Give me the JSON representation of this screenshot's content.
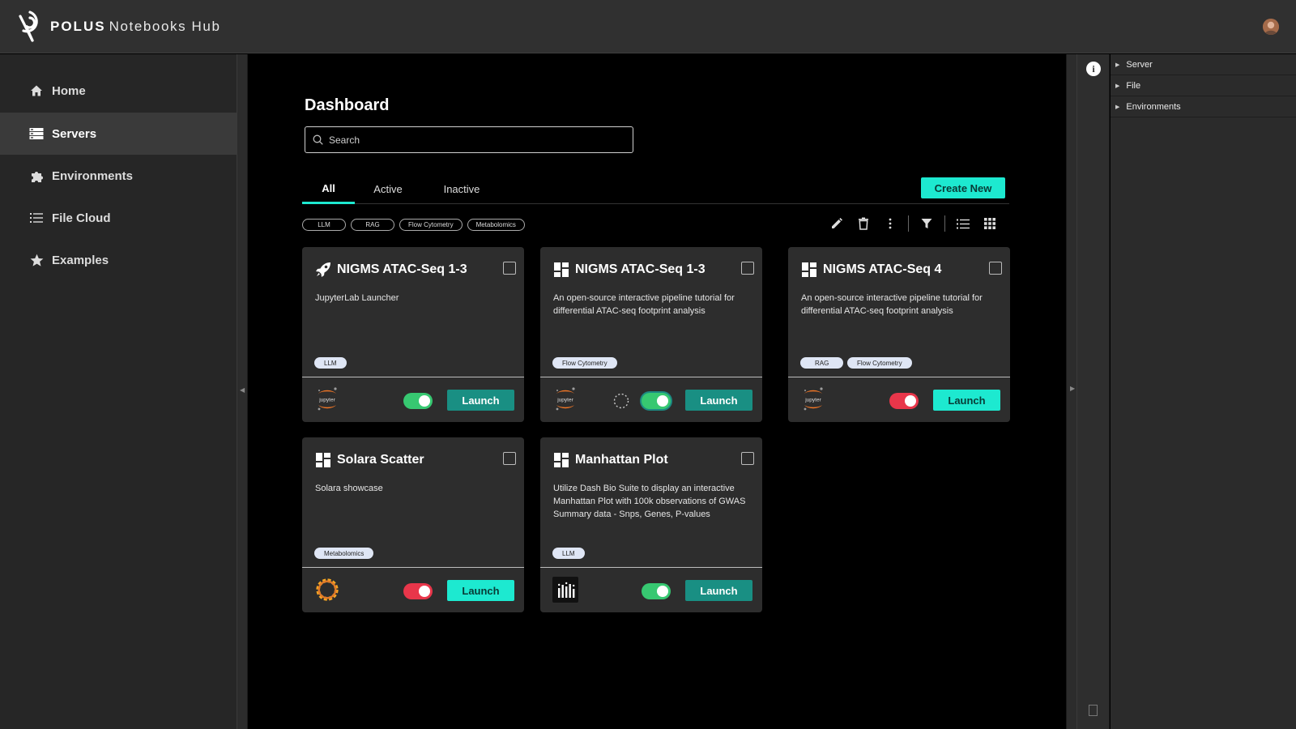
{
  "header": {
    "brand_name": "POLUS",
    "brand_suffix": "Notebooks Hub",
    "avatar_icon": "user-avatar-icon"
  },
  "sidebar": {
    "items": [
      {
        "label": "Home",
        "icon": "home-icon",
        "active": false
      },
      {
        "label": "Servers",
        "icon": "servers-icon",
        "active": true
      },
      {
        "label": "Environments",
        "icon": "puzzle-icon",
        "active": false
      },
      {
        "label": "File Cloud",
        "icon": "list-icon",
        "active": false
      },
      {
        "label": "Examples",
        "icon": "star-icon",
        "active": false
      }
    ]
  },
  "main": {
    "title": "Dashboard",
    "search": {
      "placeholder": "Search",
      "value": ""
    },
    "tabs": [
      {
        "label": "All",
        "active": true
      },
      {
        "label": "Active",
        "active": false
      },
      {
        "label": "Inactive",
        "active": false
      }
    ],
    "create_button": "Create New",
    "filter_chips": [
      "LLM",
      "RAG",
      "Flow Cytometry",
      "Metabolomics"
    ],
    "toolbar_icons": [
      "edit-icon",
      "delete-icon",
      "more-vertical-icon",
      "filter-icon",
      "list-view-icon",
      "grid-view-icon"
    ]
  },
  "cards": [
    {
      "title": "NIGMS ATAC-Seq 1-3",
      "icon": "rocket-icon",
      "description": "JupyterLab Launcher",
      "tags": [
        "LLM"
      ],
      "app": "jupyter-logo-icon",
      "app_label": "jupyter",
      "toggle": "on",
      "loading": false,
      "launch": "Launch",
      "launch_style": "dim"
    },
    {
      "title": "NIGMS ATAC-Seq 1-3",
      "icon": "dashboard-icon",
      "description": "An open-source interactive pipeline tutorial for differential ATAC-seq footprint analysis",
      "tags": [
        "Flow Cytometry"
      ],
      "app": "jupyter-logo-icon",
      "app_label": "jupyter",
      "toggle": "on",
      "loading": true,
      "launch": "Launch",
      "launch_style": "dim"
    },
    {
      "title": "NIGMS ATAC-Seq 4",
      "icon": "dashboard-icon",
      "description": "An open-source interactive pipeline tutorial for differential ATAC-seq footprint analysis",
      "tags": [
        "RAG",
        "Flow Cytometry"
      ],
      "app": "jupyter-logo-icon",
      "app_label": "jupyter",
      "toggle": "off",
      "loading": false,
      "launch": "Launch",
      "launch_style": "bright"
    },
    {
      "title": "Solara Scatter",
      "icon": "dashboard-icon",
      "description": "Solara showcase",
      "tags": [
        "Metabolomics"
      ],
      "app": "solara-logo-icon",
      "app_label": "",
      "toggle": "off",
      "loading": false,
      "launch": "Launch",
      "launch_style": "bright"
    },
    {
      "title": "Manhattan Plot",
      "icon": "dashboard-icon",
      "description": "Utilize Dash Bio Suite to display an interactive Manhattan Plot with 100k observations of GWAS Summary data - Snps, Genes, P-values",
      "tags": [
        "LLM"
      ],
      "app": "dash-logo-icon",
      "app_label": "",
      "toggle": "on",
      "loading": false,
      "launch": "Launch",
      "launch_style": "dim"
    }
  ],
  "right_panel": {
    "info_icon": "info-icon",
    "tree": [
      {
        "label": "Server"
      },
      {
        "label": "File"
      },
      {
        "label": "Environments"
      }
    ]
  },
  "colors": {
    "accent": "#1de9d0",
    "accent_dim": "#198f83",
    "toggle_on": "#37c871",
    "toggle_off": "#e8364a",
    "tag_bg": "#dfe6f5",
    "jupyter_orange": "#f37726"
  }
}
